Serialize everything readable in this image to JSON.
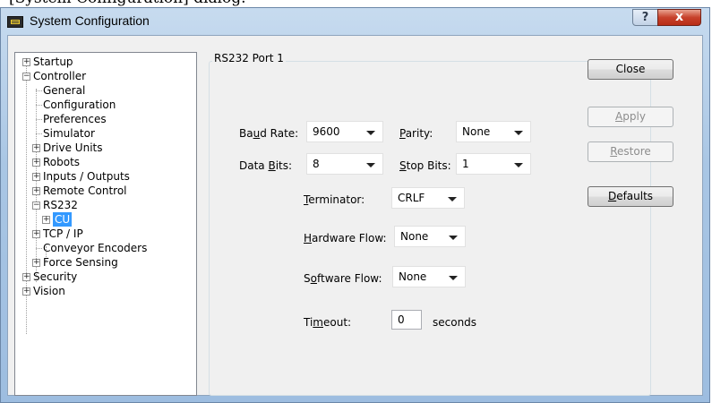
{
  "caption": "[System Configuration] dialog.",
  "window": {
    "title": "System Configuration",
    "help_glyph": "?",
    "close_glyph": "x"
  },
  "tree": {
    "items": [
      {
        "label": "Startup",
        "level": 0,
        "expander": "+"
      },
      {
        "label": "Controller",
        "level": 0,
        "expander": "-"
      },
      {
        "label": "General",
        "level": 1,
        "expander": ""
      },
      {
        "label": "Configuration",
        "level": 1,
        "expander": ""
      },
      {
        "label": "Preferences",
        "level": 1,
        "expander": ""
      },
      {
        "label": "Simulator",
        "level": 1,
        "expander": ""
      },
      {
        "label": "Drive Units",
        "level": 1,
        "expander": "+"
      },
      {
        "label": "Robots",
        "level": 1,
        "expander": "+"
      },
      {
        "label": "Inputs / Outputs",
        "level": 1,
        "expander": "+"
      },
      {
        "label": "Remote Control",
        "level": 1,
        "expander": "+"
      },
      {
        "label": "RS232",
        "level": 1,
        "expander": "-"
      },
      {
        "label": "CU",
        "level": 2,
        "expander": "+",
        "selected": true
      },
      {
        "label": "TCP / IP",
        "level": 1,
        "expander": "+"
      },
      {
        "label": "Conveyor Encoders",
        "level": 1,
        "expander": ""
      },
      {
        "label": "Force Sensing",
        "level": 1,
        "expander": "+"
      },
      {
        "label": "Security",
        "level": 0,
        "expander": "+"
      },
      {
        "label": "Vision",
        "level": 0,
        "expander": "+"
      }
    ]
  },
  "panel": {
    "group_title": "RS232 Port 1",
    "baud_rate": {
      "pre": "Ba",
      "key": "u",
      "post": "d Rate:",
      "value": "9600"
    },
    "parity": {
      "pre": "",
      "key": "P",
      "post": "arity:",
      "value": "None"
    },
    "data_bits": {
      "pre": "Data ",
      "key": "B",
      "post": "its:",
      "value": "8"
    },
    "stop_bits": {
      "pre": "",
      "key": "S",
      "post": "top Bits:",
      "value": "1"
    },
    "terminator": {
      "pre": "",
      "key": "T",
      "post": "erminator:",
      "value": "CRLF"
    },
    "hardware_flow": {
      "pre": "",
      "key": "H",
      "post": "ardware Flow:",
      "value": "None"
    },
    "software_flow": {
      "pre": "S",
      "key": "o",
      "post": "ftware Flow:",
      "value": "None"
    },
    "timeout": {
      "pre": "Ti",
      "key": "m",
      "post": "eout:",
      "value": "0",
      "unit": "seconds"
    }
  },
  "buttons": {
    "close": {
      "label": "Close",
      "enabled": true
    },
    "apply": {
      "pre": "",
      "key": "A",
      "post": "pply",
      "enabled": false
    },
    "restore": {
      "pre": "",
      "key": "R",
      "post": "estore",
      "enabled": false
    },
    "defaults": {
      "pre": "",
      "key": "D",
      "post": "efaults",
      "enabled": true
    }
  }
}
